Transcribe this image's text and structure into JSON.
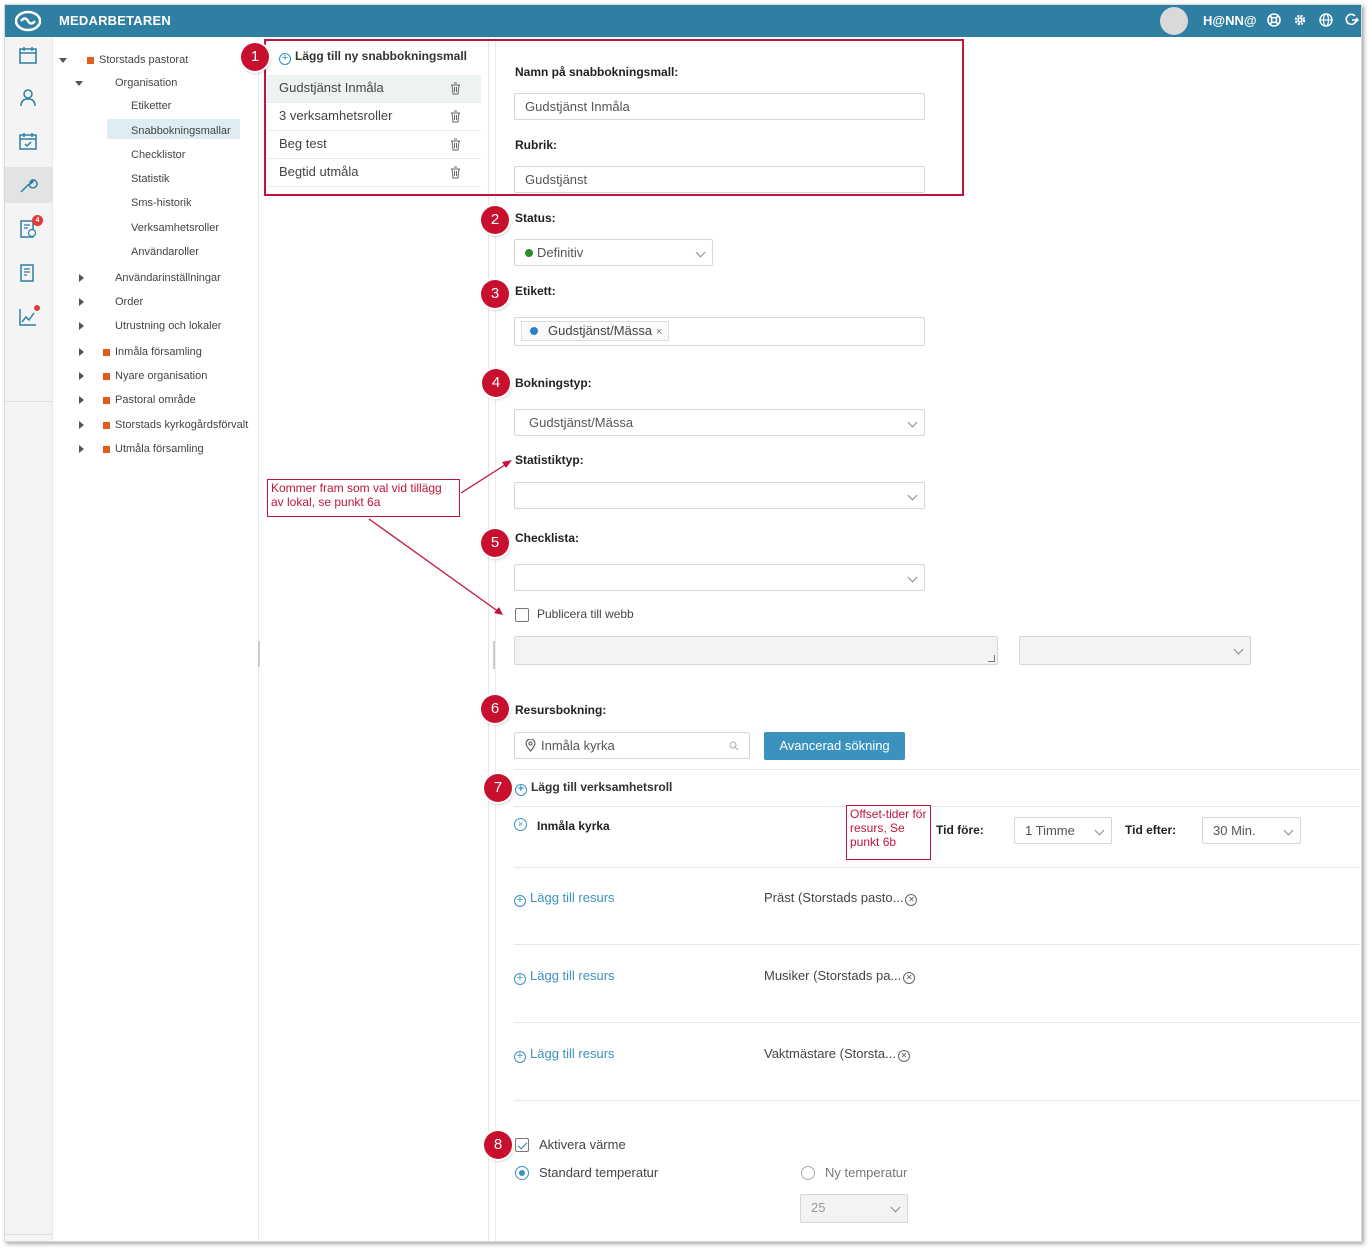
{
  "header": {
    "app_title": "MEDARBETAREN",
    "username": "H@NN@"
  },
  "rail": {
    "badge_count": "4"
  },
  "tree": {
    "root": "Storstads pastorat",
    "organisation": "Organisation",
    "org_children": [
      "Etiketter",
      "Snabbokningsmallar",
      "Checklistor",
      "Statistik",
      "Sms-historik",
      "Verksamhetsroller",
      "Användaroller"
    ],
    "groups": [
      "Användarinställningar",
      "Order",
      "Utrustning och lokaler"
    ],
    "orgs": [
      "Inmåla församling",
      "Nyare organisation",
      "Pastoral område",
      "Storstads kyrkogårdsförvalt",
      "Utmåla församling"
    ]
  },
  "templates": {
    "add_label": "Lägg till ny snabbokningsmall",
    "items": [
      "Gudstjänst Inmåla",
      "3 verksamhetsroller",
      "Beg test",
      "Begtid utmåla"
    ]
  },
  "form": {
    "name_label": "Namn på snabbokningsmall:",
    "name_value": "Gudstjänst Inmåla",
    "rubrik_label": "Rubrik:",
    "rubrik_value": "Gudstjänst",
    "status_label": "Status:",
    "status_value": "Definitiv",
    "etikett_label": "Etikett:",
    "etikett_tag": "Gudstjänst/Mässa",
    "bokningstyp_label": "Bokningstyp:",
    "bokningstyp_value": "Gudstjänst/Mässa",
    "statistiktyp_label": "Statistiktyp:",
    "checklista_label": "Checklista:",
    "publicera_label": "Publicera till webb",
    "resursbokning_label": "Resursbokning:",
    "resurs_search_value": "Inmåla kyrka",
    "advanced_search": "Avancerad sökning",
    "add_role": "Lägg till verksamhetsroll",
    "resource_name": "Inmåla kyrka",
    "tid_fore_label": "Tid före:",
    "tid_fore_value": "1 Timme",
    "tid_efter_label": "Tid efter:",
    "tid_efter_value": "30 Min.",
    "add_resource": "Lägg till resurs",
    "roles": [
      "Präst (Storstads pasto...",
      "Musiker (Storstads pa...",
      "Vaktmästare (Storsta..."
    ],
    "aktivera_varme": "Aktivera värme",
    "standard_temp": "Standard temperatur",
    "ny_temp": "Ny temperatur",
    "temp_value": "25"
  },
  "annotations": {
    "numbers": [
      "1",
      "2",
      "3",
      "4",
      "5",
      "6",
      "7",
      "8"
    ],
    "note_statistik": "Kommer fram som val vid tillägg av lokal, se punkt 6a",
    "note_offset": "Offset-tider för resurs, Se punkt 6b"
  },
  "colors": {
    "header": "#2f7fa3",
    "accent": "#3b92bf",
    "annotation": "#c0143c",
    "status_green": "#2e8b2e"
  }
}
